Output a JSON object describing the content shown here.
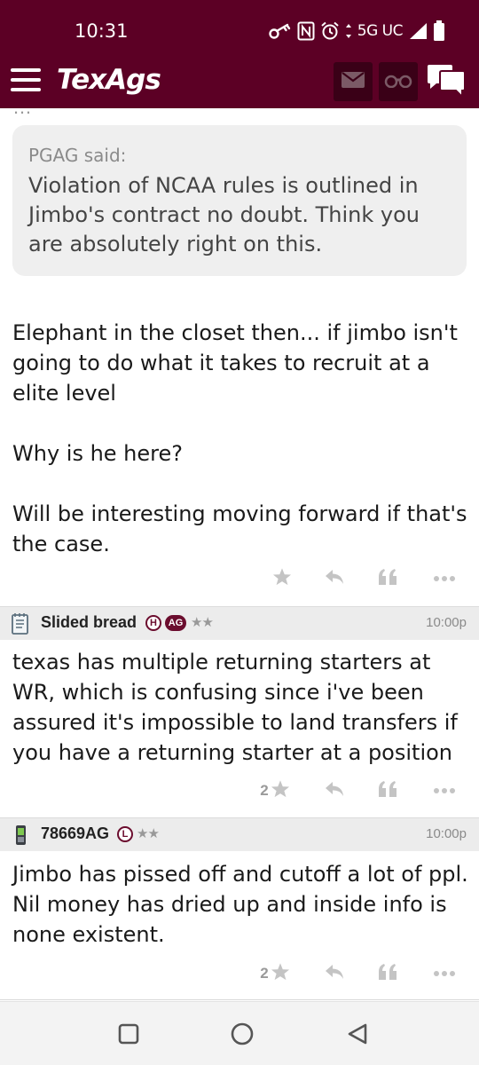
{
  "status_bar": {
    "time": "10:31",
    "network": "5G UC",
    "icons": [
      "vpn-key-icon",
      "nfc-icon",
      "alarm-icon",
      "data-arrows-icon",
      "signal-icon",
      "battery-icon"
    ]
  },
  "app_bar": {
    "logo": "TexAgs",
    "icons": [
      "menu-icon",
      "mail-icon",
      "binoculars-icon",
      "chat-icon"
    ],
    "colors": {
      "bar": "#5c0025",
      "button_bg": "#3a0017"
    }
  },
  "quote": {
    "author": "PGAG said:",
    "text": "Violation of NCAA rules is outlined in Jimbo's contract no doubt. Think you are absolutely right on this."
  },
  "posts": [
    {
      "paragraphs": [
        "Elephant in the closet then... if jimbo isn't going to do what it takes to recruit at a elite level",
        "Why is he here?",
        "Will be interesting moving forward if that's the case."
      ],
      "star_count": ""
    },
    {
      "author": "Slided bread",
      "author_icon": "notepad-icon",
      "badges": [
        "H",
        "AG"
      ],
      "stars": "★★",
      "time": "10:00p",
      "paragraphs": [
        "texas has multiple returning starters at WR, which is confusing since i've been assured it's impossible to land transfers if you have a returning starter at a position"
      ],
      "star_count": "2"
    },
    {
      "author": "78669AG",
      "author_icon": "phone-icon",
      "badges": [
        "L"
      ],
      "stars": "★★",
      "time": "10:00p",
      "paragraphs": [
        "Jimbo has pissed off and cutoff a lot of ppl. Nil money has dried up and inside info is none existent."
      ],
      "star_count": "2"
    }
  ],
  "nav_bar": {
    "icons": [
      "recents-square-icon",
      "home-circle-icon",
      "back-triangle-icon"
    ]
  }
}
